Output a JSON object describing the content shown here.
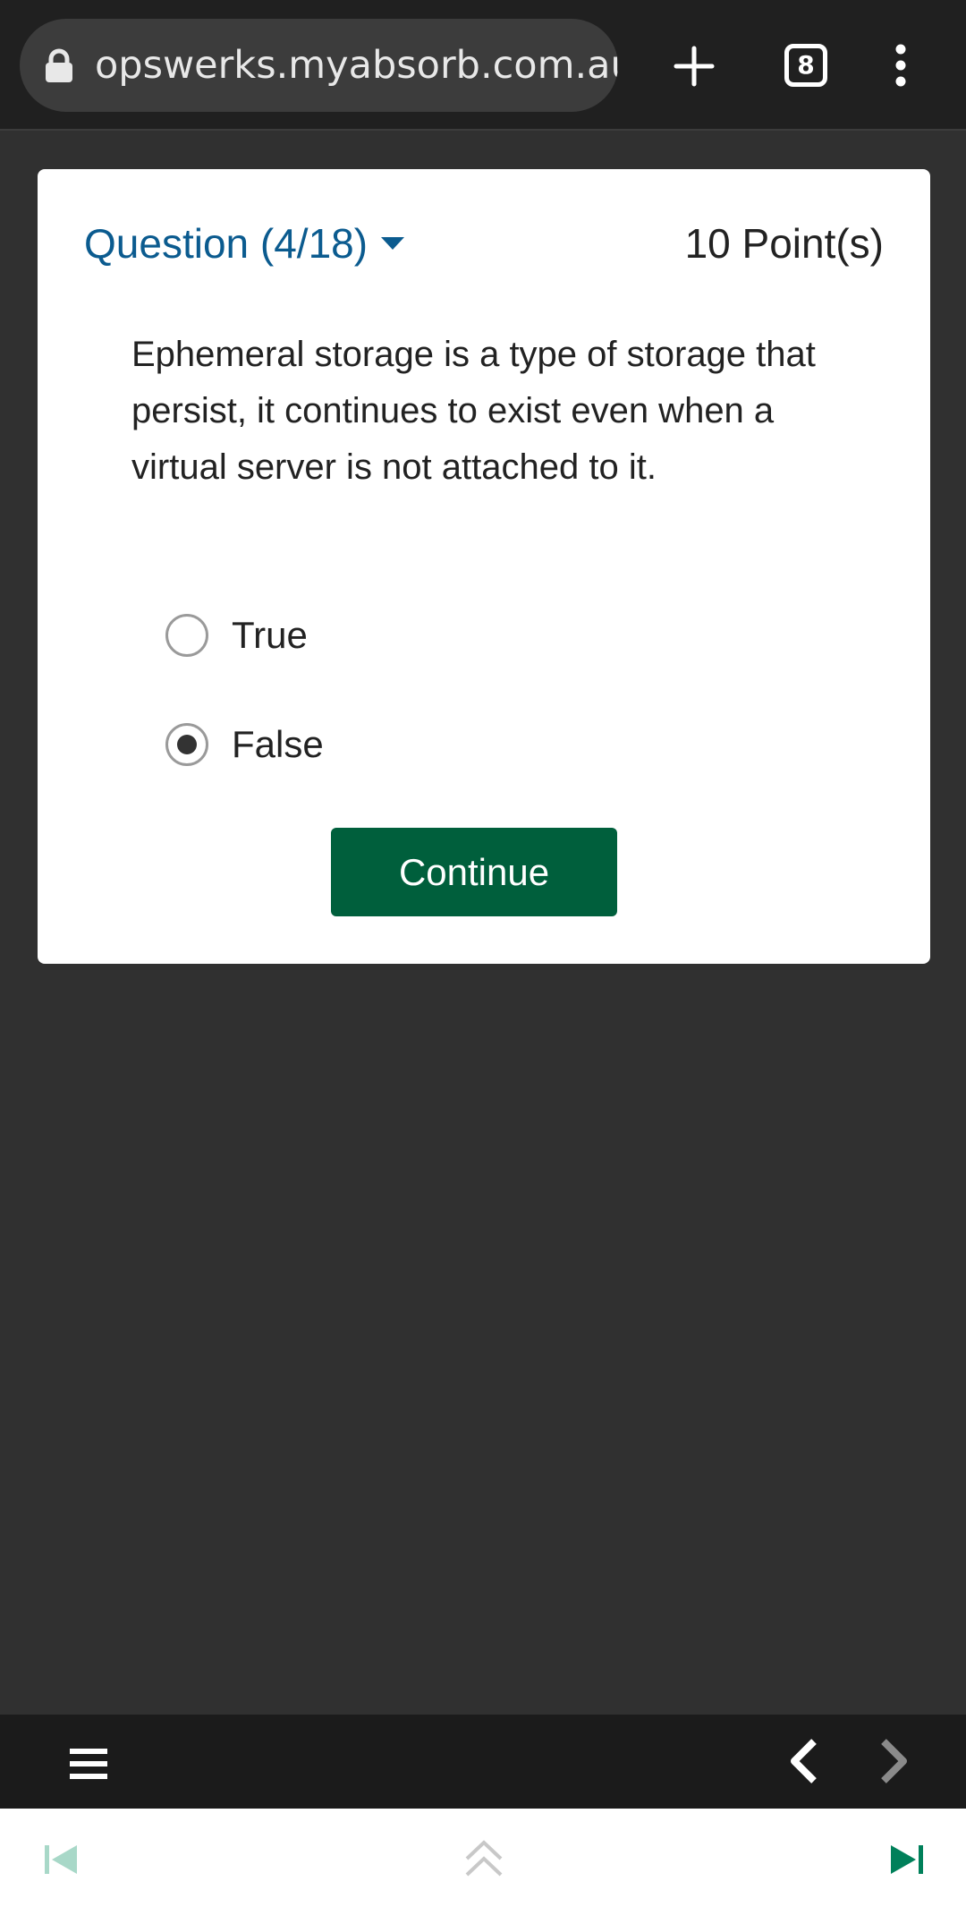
{
  "browser": {
    "url": "opswerks.myabsorb.com.au",
    "tab_count": "8"
  },
  "question": {
    "header": "Question (4/18)",
    "points": "10 Point(s)",
    "text": "Ephemeral storage is a type of storage that persist, it continues to exist even when a virtual server is not attached to it.",
    "options": [
      {
        "label": "True",
        "selected": false
      },
      {
        "label": "False",
        "selected": true
      }
    ],
    "continue_label": "Continue"
  },
  "colors": {
    "question_header": "#0b5b8f",
    "continue_button": "#005f3c",
    "page_background": "#303030",
    "nav_accent": "#00805a"
  },
  "icons": [
    "lock-icon",
    "plus-icon",
    "tabs-icon",
    "more-vert-icon",
    "caret-down-icon",
    "hamburger-icon",
    "chevron-left-icon",
    "chevron-right-icon",
    "skip-first-icon",
    "double-chevron-up-icon",
    "skip-last-icon"
  ]
}
